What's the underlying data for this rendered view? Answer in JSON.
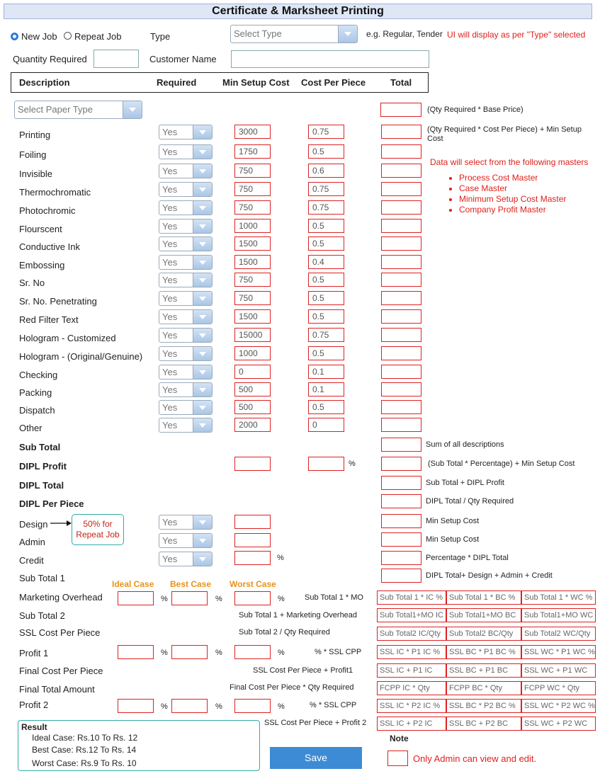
{
  "title": "Certificate & Marksheet Printing",
  "top": {
    "new_job": "New Job",
    "repeat_job": "Repeat Job",
    "type_label": "Type",
    "type_placeholder": "Select Type",
    "type_hint": "e.g. Regular, Tender",
    "type_note": "UI will display as per \"Type\" selected",
    "qty_label": "Quantity Required",
    "customer_label": "Customer Name"
  },
  "header": {
    "description": "Description",
    "required": "Required",
    "min_setup": "Min Setup Cost",
    "cost_per_piece": "Cost Per Piece",
    "total": "Total"
  },
  "paper": {
    "placeholder": "Select Paper Type",
    "formula": "(Qty Required * Base Price)"
  },
  "rows": [
    {
      "name": "Printing",
      "required": "Yes",
      "min_setup": "3000",
      "cpp": "0.75"
    },
    {
      "name": "Foiling",
      "required": "Yes",
      "min_setup": "1750",
      "cpp": "0.5"
    },
    {
      "name": "Invisible",
      "required": "Yes",
      "min_setup": "750",
      "cpp": "0.6"
    },
    {
      "name": "Thermochromatic",
      "required": "Yes",
      "min_setup": "750",
      "cpp": "0.75"
    },
    {
      "name": "Photochromic",
      "required": "Yes",
      "min_setup": "750",
      "cpp": "0.75"
    },
    {
      "name": "Flourscent",
      "required": "Yes",
      "min_setup": "1000",
      "cpp": "0.5"
    },
    {
      "name": "Conductive Ink",
      "required": "Yes",
      "min_setup": "1500",
      "cpp": "0.5"
    },
    {
      "name": "Embossing",
      "required": "Yes",
      "min_setup": "1500",
      "cpp": "0.4"
    },
    {
      "name": "Sr. No",
      "required": "Yes",
      "min_setup": "750",
      "cpp": "0.5"
    },
    {
      "name": "Sr. No. Penetrating",
      "required": "Yes",
      "min_setup": "750",
      "cpp": "0.5"
    },
    {
      "name": "Red Filter Text",
      "required": "Yes",
      "min_setup": "1500",
      "cpp": "0.5"
    },
    {
      "name": "Hologram - Customized",
      "required": "Yes",
      "min_setup": "15000",
      "cpp": "0.75"
    },
    {
      "name": "Hologram - (Original/Genuine)",
      "required": "Yes",
      "min_setup": "1000",
      "cpp": "0.5"
    },
    {
      "name": "Checking",
      "required": "Yes",
      "min_setup": "0",
      "cpp": "0.1"
    },
    {
      "name": "Packing",
      "required": "Yes",
      "min_setup": "500",
      "cpp": "0.1"
    },
    {
      "name": "Dispatch",
      "required": "Yes",
      "min_setup": "500",
      "cpp": "0.5"
    },
    {
      "name": "Other",
      "required": "Yes",
      "min_setup": "2000",
      "cpp": "0"
    }
  ],
  "printing_formula": "(Qty Required * Cost Per Piece) + Min Setup Cost",
  "masters_note": "Data will select from the following masters",
  "masters": [
    "Process Cost Master",
    "Case Master",
    "Minimum Setup Cost Master",
    "Company Profit Master"
  ],
  "summary": {
    "sub_total": "Sub Total",
    "sub_total_formula": "Sum of all descriptions",
    "dipl_profit": "DIPL Profit",
    "percent": "%",
    "dipl_profit_formula": "(Sub Total * Percentage) + Min Setup Cost",
    "dipl_total": "DIPL Total",
    "dipl_total_formula": "Sub Total + DIPL Profit",
    "dipl_per_piece": "DIPL Per Piece",
    "dipl_per_piece_formula": "DIPL Total / Qty Required"
  },
  "extras": {
    "design": "Design",
    "callout": "50% for Repeat Job",
    "design_formula": "Min Setup Cost",
    "admin": "Admin",
    "admin_formula": "Min Setup Cost",
    "credit": "Credit",
    "credit_formula": "Percentage * DIPL Total",
    "required": "Yes",
    "sub_total_1": "Sub Total 1",
    "sub_total_1_formula": "DIPL Total+ Design + Admin + Credit"
  },
  "cases": {
    "ideal": "Ideal Case",
    "best": "Best Case",
    "worst": "Worst Case"
  },
  "calc": {
    "marketing_overhead": "Marketing Overhead",
    "mo_formula": "Sub Total 1 * MO",
    "mo_cells": [
      "Sub Total 1 * IC %",
      "Sub Total 1 * BC %",
      "Sub Total 1 * WC %"
    ],
    "sub_total_2": "Sub Total 2",
    "st2_formula": "Sub Total 1 + Marketing Overhead",
    "st2_cells": [
      "Sub Total1+MO IC",
      "Sub Total1+MO BC",
      "Sub Total1+MO WC"
    ],
    "ssl_cpp": "SSL Cost Per Piece",
    "ssl_formula": "Sub Total 2 / Qty Required",
    "ssl_cells": [
      "Sub Total2 IC/Qty",
      "Sub Total2 BC/Qty",
      "Sub Total2 WC/Qty"
    ],
    "profit_1": "Profit 1",
    "p1_formula": "% * SSL CPP",
    "p1_cells": [
      "SSL IC * P1 IC %",
      "SSL BC * P1 BC %",
      "SSL WC * P1 WC %"
    ],
    "final_cpp": "Final Cost Per Piece",
    "fcpp_formula": "SSL Cost Per Piece + Profit1",
    "fcpp_cells": [
      "SSL IC + P1 IC",
      "SSL BC + P1 BC",
      "SSL WC + P1 WC"
    ],
    "final_total": "Final Total Amount",
    "ft_formula": "Final Cost Per Piece * Qty Required",
    "ft_cells": [
      "FCPP IC * Qty",
      "FCPP BC * Qty",
      "FCPP WC * Qty"
    ],
    "profit_2": "Profit 2",
    "p2_formula": "% * SSL CPP",
    "p2_cells": [
      "SSL IC * P2 IC %",
      "SSL BC * P2 BC %",
      "SSL WC * P2 WC %"
    ],
    "last_formula": "SSL Cost Per Piece + Profit 2",
    "last_cells": [
      "SSL IC + P2 IC",
      "SSL BC + P2 BC",
      "SSL WC + P2 WC"
    ]
  },
  "result": {
    "title": "Result",
    "ideal": "Ideal Case: Rs.10 To Rs. 12",
    "best": "Best Case: Rs.12 To Rs. 14",
    "worst": "Worst Case: Rs.9 To Rs. 10"
  },
  "save_label": "Save",
  "note": {
    "label": "Note",
    "text": "Only Admin can view and edit."
  }
}
